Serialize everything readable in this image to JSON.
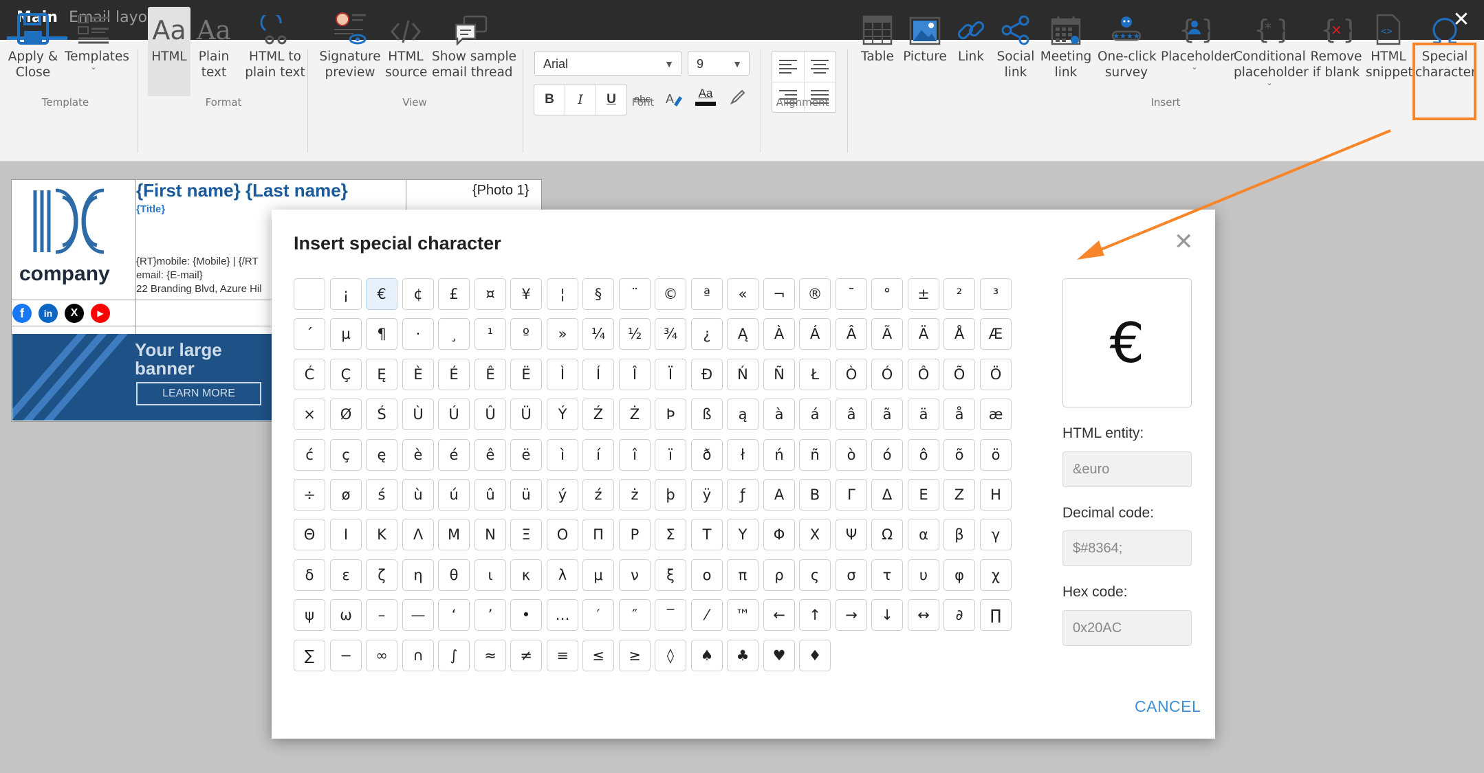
{
  "tabs": [
    {
      "label": "Main",
      "active": true
    },
    {
      "label": "Email layout",
      "active": false
    }
  ],
  "window": {
    "close_glyph": "✕"
  },
  "ribbon": {
    "template": {
      "apply": "Apply &\nClose",
      "templates": "Templates",
      "group": "Template"
    },
    "format": {
      "html": "HTML",
      "plain": "Plain\ntext",
      "html_to_plain": "HTML to\nplain text",
      "group": "Format"
    },
    "view": {
      "sig_preview": "Signature\npreview",
      "html_source": "HTML\nsource",
      "show_thread": "Show sample\nemail thread",
      "group": "View"
    },
    "font": {
      "family": "Arial",
      "size": "9",
      "bold": "B",
      "italic": "I",
      "underline": "U",
      "strike": "abc",
      "color_glyph": "Aa",
      "group": "Font"
    },
    "alignment": {
      "group": "Alignment"
    },
    "insert": {
      "table": "Table",
      "picture": "Picture",
      "link": "Link",
      "social": "Social\nlink",
      "meeting": "Meeting\nlink",
      "survey": "One-click\nsurvey",
      "placeholder": "Placeholder",
      "conditional": "Conditional\nplaceholder",
      "remove_blank": "Remove\nif blank",
      "html_snippet": "HTML\nsnippet",
      "special": "Special\ncharacter",
      "group": "Insert"
    }
  },
  "signature": {
    "name": "{First name} {Last name}",
    "title": "{Title}",
    "photo": "{Photo 1}",
    "mobile_line": "{RT}mobile: {Mobile}  |  {/RT",
    "email_line": "email: {E-mail}",
    "address_line": "22 Branding Blvd, Azure Hil",
    "company": "company",
    "banner_title": "Your large\nbanner",
    "banner_button": "LEARN MORE"
  },
  "dialog": {
    "title": "Insert special character",
    "close_glyph": "✕",
    "selected_index": 2,
    "chars": [
      " ",
      "¡",
      "€",
      "¢",
      "£",
      "¤",
      "¥",
      "¦",
      "§",
      "¨",
      "©",
      "ª",
      "«",
      "¬",
      "®",
      "¯",
      "°",
      "±",
      "²",
      "³",
      "´",
      "µ",
      "¶",
      "·",
      "¸",
      "¹",
      "º",
      "»",
      "¼",
      "½",
      "¾",
      "¿",
      "Ą",
      "À",
      "Á",
      "Â",
      "Ã",
      "Ä",
      "Å",
      "Æ",
      "Ć",
      "Ç",
      "Ę",
      "È",
      "É",
      "Ê",
      "Ë",
      "Ì",
      "Í",
      "Î",
      "Ï",
      "Ð",
      "Ń",
      "Ñ",
      "Ł",
      "Ò",
      "Ó",
      "Ô",
      "Õ",
      "Ö",
      "×",
      "Ø",
      "Ś",
      "Ù",
      "Ú",
      "Û",
      "Ü",
      "Ý",
      "Ź",
      "Ż",
      "Þ",
      "ß",
      "ą",
      "à",
      "á",
      "â",
      "ã",
      "ä",
      "å",
      "æ",
      "ć",
      "ç",
      "ę",
      "è",
      "é",
      "ê",
      "ë",
      "ì",
      "í",
      "î",
      "ï",
      "ð",
      "ł",
      "ń",
      "ñ",
      "ò",
      "ó",
      "ô",
      "õ",
      "ö",
      "÷",
      "ø",
      "ś",
      "ù",
      "ú",
      "û",
      "ü",
      "ý",
      "ź",
      "ż",
      "þ",
      "ÿ",
      "ƒ",
      "Α",
      "Β",
      "Γ",
      "Δ",
      "Ε",
      "Ζ",
      "Η",
      "Θ",
      "Ι",
      "Κ",
      "Λ",
      "Μ",
      "Ν",
      "Ξ",
      "Ο",
      "Π",
      "Ρ",
      "Σ",
      "Τ",
      "Υ",
      "Φ",
      "Χ",
      "Ψ",
      "Ω",
      "α",
      "β",
      "γ",
      "δ",
      "ε",
      "ζ",
      "η",
      "θ",
      "ι",
      "κ",
      "λ",
      "μ",
      "ν",
      "ξ",
      "ο",
      "π",
      "ρ",
      "ς",
      "σ",
      "τ",
      "υ",
      "φ",
      "χ",
      "ψ",
      "ω",
      "–",
      "—",
      "‘",
      "’",
      "•",
      "…",
      "′",
      "″",
      "‾",
      "⁄",
      "™",
      "←",
      "↑",
      "→",
      "↓",
      "↔",
      "∂",
      "∏",
      "∑",
      "−",
      "∞",
      "∩",
      "∫",
      "≈",
      "≠",
      "≡",
      "≤",
      "≥",
      "◊",
      "♠",
      "♣",
      "♥",
      "♦"
    ],
    "preview_char": "€",
    "html_entity_label": "HTML entity:",
    "html_entity_value": "&euro",
    "decimal_label": "Decimal code:",
    "decimal_value": "$#8364;",
    "hex_label": "Hex code:",
    "hex_value": "0x20AC",
    "cancel": "CANCEL"
  },
  "colors": {
    "accent_orange": "#f7862b",
    "tab_underline": "#1f76c7",
    "link_blue": "#3c8fd6",
    "icon_blue": "#1f6fc1"
  }
}
